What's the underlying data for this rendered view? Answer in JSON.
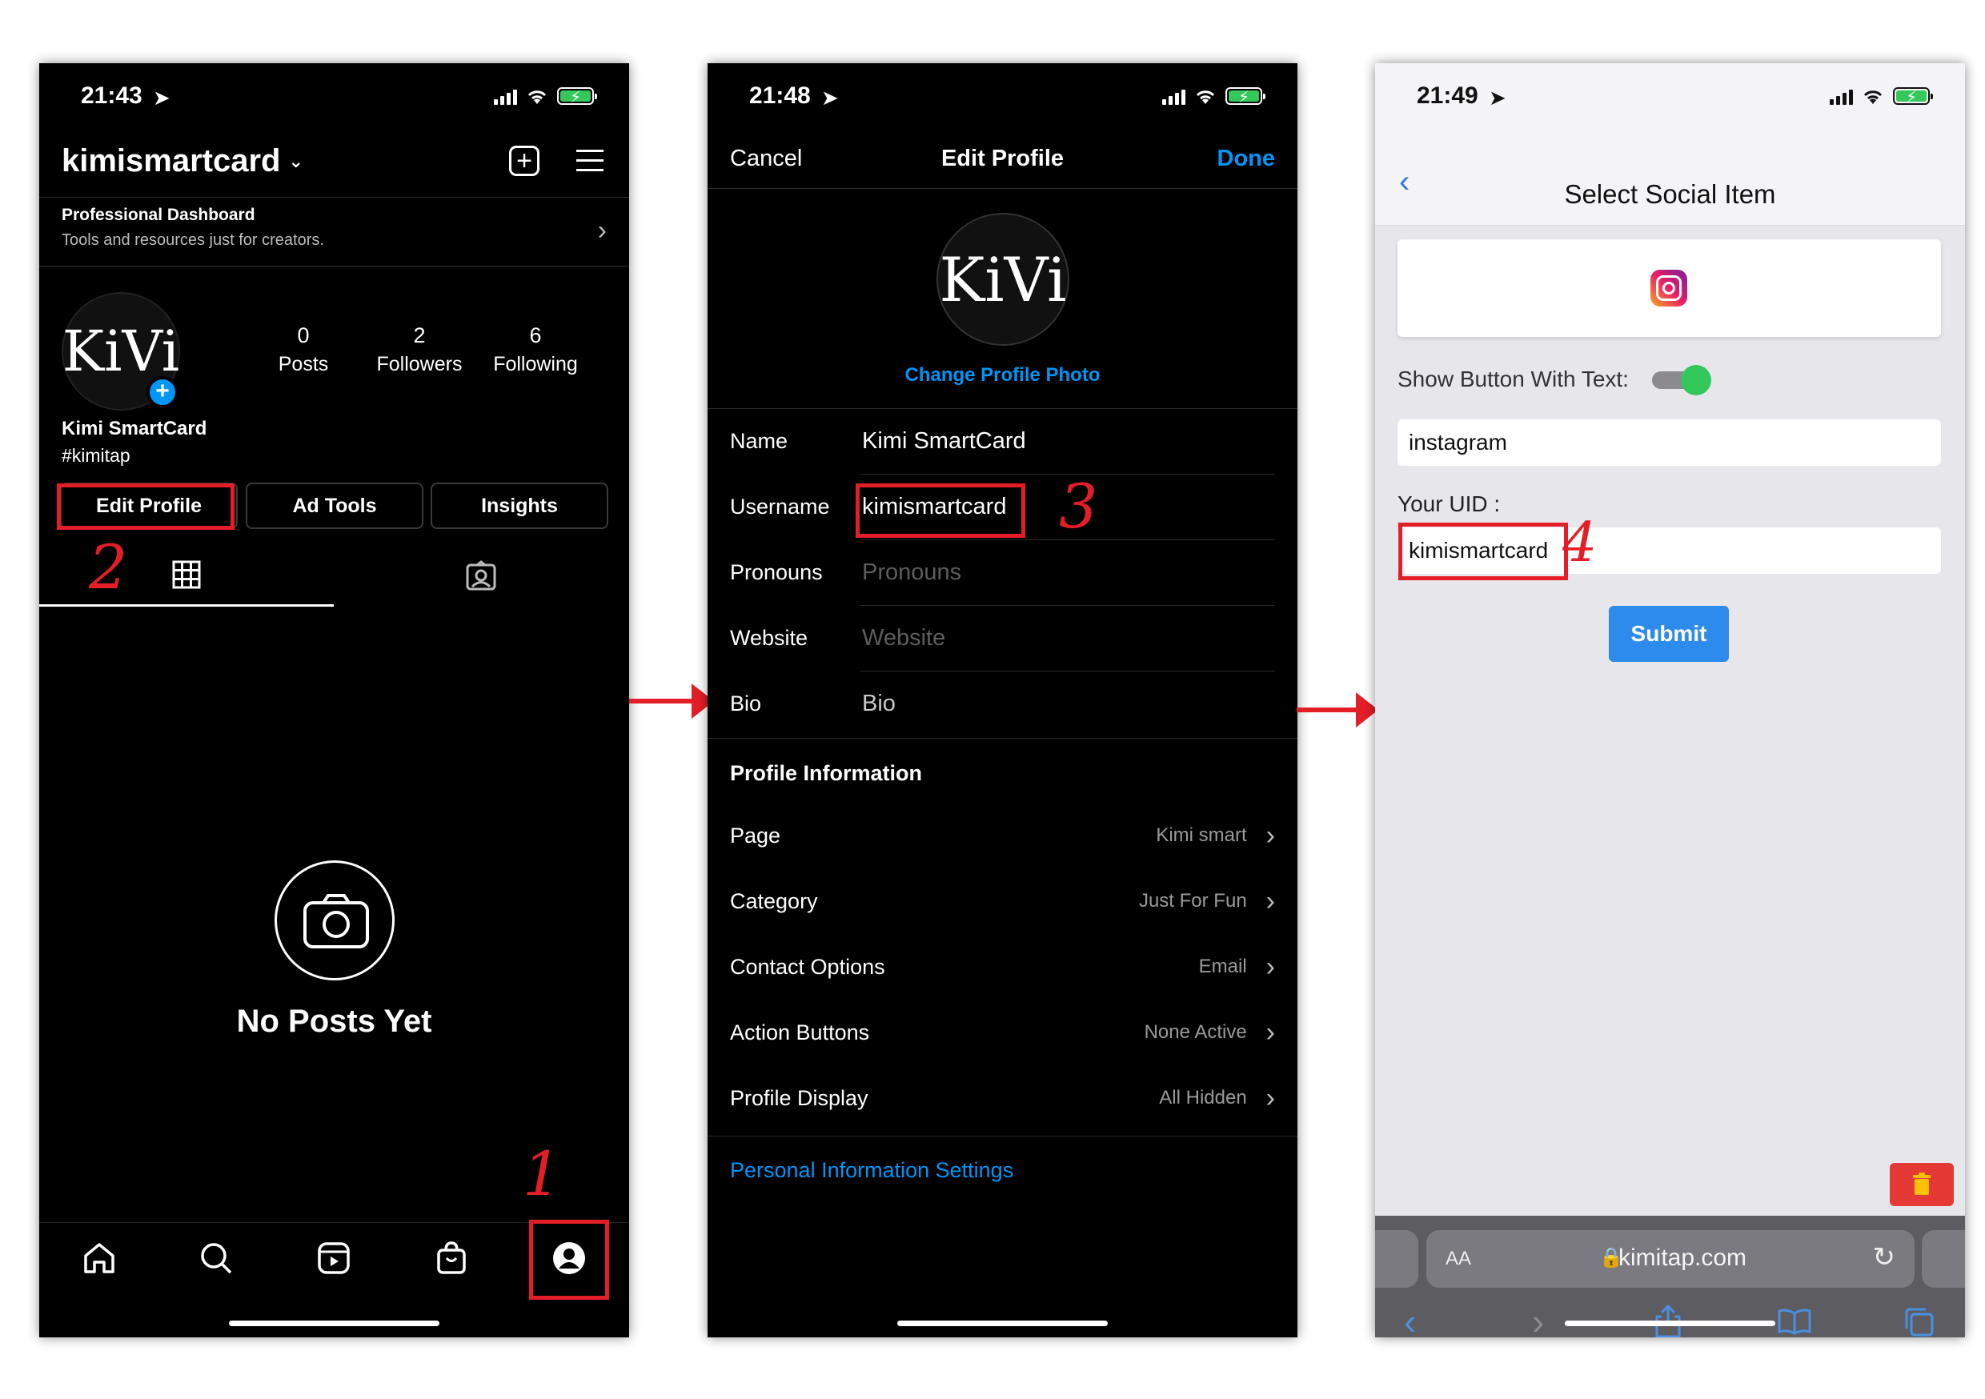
{
  "phone1": {
    "status": {
      "time": "21:43"
    },
    "header": {
      "username": "kimismartcard"
    },
    "dashboard": {
      "title": "Professional Dashboard",
      "subtitle": "Tools and resources just for creators."
    },
    "profile": {
      "avatar_text": "KiVi",
      "name": "Kimi SmartCard",
      "tag": "#kimitap"
    },
    "stats": [
      {
        "value": "0",
        "label": "Posts"
      },
      {
        "value": "2",
        "label": "Followers"
      },
      {
        "value": "6",
        "label": "Following"
      }
    ],
    "buttons": {
      "edit_profile": "Edit Profile",
      "ad_tools": "Ad Tools",
      "insights": "Insights"
    },
    "empty": {
      "text": "No Posts Yet"
    },
    "nav_icons": [
      "home-icon",
      "search-icon",
      "reels-icon",
      "shop-icon",
      "profile-icon"
    ],
    "annotations": {
      "step1": "1",
      "step2": "2"
    }
  },
  "phone2": {
    "status": {
      "time": "21:48"
    },
    "header": {
      "cancel": "Cancel",
      "title": "Edit Profile",
      "done": "Done"
    },
    "avatar_text": "KiVi",
    "change_photo": "Change Profile Photo",
    "fields": {
      "name": {
        "label": "Name",
        "value": "Kimi SmartCard"
      },
      "username": {
        "label": "Username",
        "value": "kimismartcard"
      },
      "pronouns": {
        "label": "Pronouns",
        "placeholder": "Pronouns"
      },
      "website": {
        "label": "Website",
        "placeholder": "Website"
      },
      "bio": {
        "label": "Bio",
        "placeholder": "Bio"
      }
    },
    "profile_info": {
      "heading": "Profile Information",
      "rows": [
        {
          "label": "Page",
          "value": "Kimi smart"
        },
        {
          "label": "Category",
          "value": "Just For Fun"
        },
        {
          "label": "Contact Options",
          "value": "Email"
        },
        {
          "label": "Action Buttons",
          "value": "None Active"
        },
        {
          "label": "Profile Display",
          "value": "All Hidden"
        }
      ]
    },
    "personal_settings": "Personal Information Settings",
    "annotations": {
      "step3": "3"
    }
  },
  "phone3": {
    "status": {
      "time": "21:49"
    },
    "header": {
      "title": "Select Social Item"
    },
    "toggle_label": "Show Button With Text:",
    "button_text_value": "instagram",
    "uid_label": "Your UID :",
    "uid_value": "kimismartcard",
    "submit": "Submit",
    "browser": {
      "aa": "AA",
      "url": "kimitap.com"
    },
    "annotations": {
      "step4": "4"
    }
  },
  "colors": {
    "instagram_blue": "#0095f6",
    "ios_blue": "#2a7ae2",
    "highlight_red": "#e41e26",
    "toggle_green": "#34c759"
  }
}
